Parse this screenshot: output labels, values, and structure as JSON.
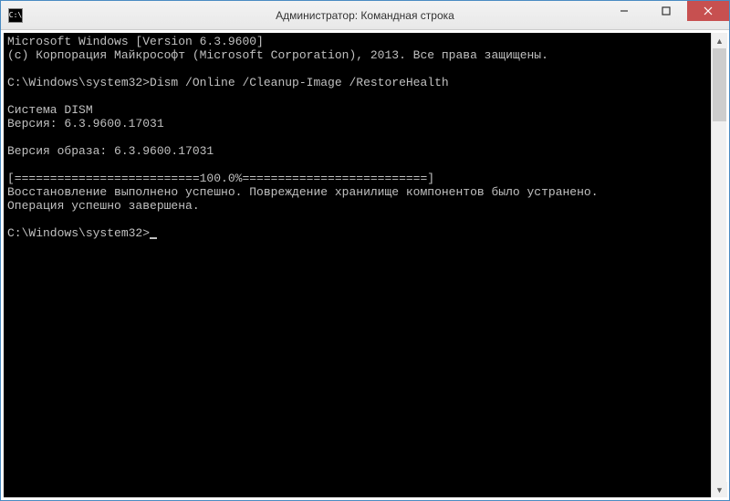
{
  "window": {
    "title": "Администратор: Командная строка",
    "icon_label": "C:\\"
  },
  "console": {
    "lines": [
      "Microsoft Windows [Version 6.3.9600]",
      "(c) Корпорация Майкрософт (Microsoft Corporation), 2013. Все права защищены.",
      "",
      "C:\\Windows\\system32>Dism /Online /Cleanup-Image /RestoreHealth",
      "",
      "Cистема DISM",
      "Версия: 6.3.9600.17031",
      "",
      "Версия образа: 6.3.9600.17031",
      "",
      "[==========================100.0%==========================]",
      "Восстановление выполнено успешно. Повреждение хранилище компонентов было устранено.",
      "Операция успешно завершена.",
      "",
      "C:\\Windows\\system32>"
    ]
  }
}
